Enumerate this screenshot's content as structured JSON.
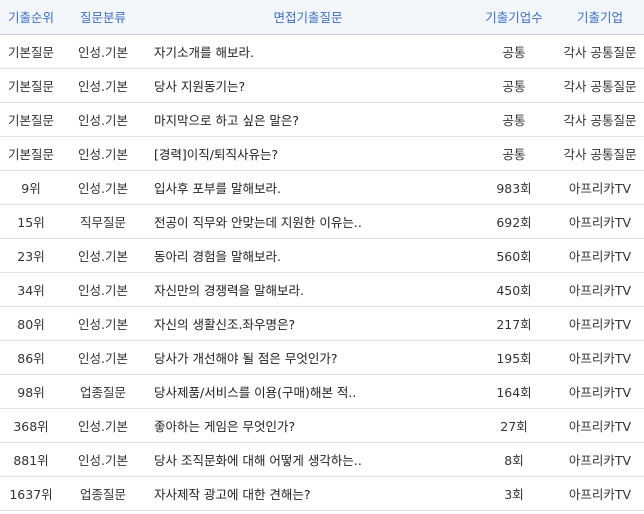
{
  "table": {
    "headers": [
      "기출순위",
      "질문분류",
      "면접기출질문",
      "기출기업수",
      "기출기업"
    ],
    "rows": [
      {
        "rank": "기본질문",
        "category": "인성.기본",
        "question": "자기소개를 해보라.",
        "count": "공통",
        "company": "각사 공통질문"
      },
      {
        "rank": "기본질문",
        "category": "인성.기본",
        "question": "당사 지원동기는?",
        "count": "공통",
        "company": "각사 공통질문"
      },
      {
        "rank": "기본질문",
        "category": "인성.기본",
        "question": "마지막으로 하고 싶은 말은?",
        "count": "공통",
        "company": "각사 공통질문"
      },
      {
        "rank": "기본질문",
        "category": "인성.기본",
        "question": "[경력]이직/퇴직사유는?",
        "count": "공통",
        "company": "각사 공통질문"
      },
      {
        "rank": "9위",
        "category": "인성.기본",
        "question": "입사후 포부를 말해보라.",
        "count": "983회",
        "company": "아프리카TV"
      },
      {
        "rank": "15위",
        "category": "직무질문",
        "question": "전공이 직무와 안맞는데 지원한 이유는..",
        "count": "692회",
        "company": "아프리카TV"
      },
      {
        "rank": "23위",
        "category": "인성.기본",
        "question": "동아리 경험을 말해보라.",
        "count": "560회",
        "company": "아프리카TV"
      },
      {
        "rank": "34위",
        "category": "인성.기본",
        "question": "자신만의 경쟁력을 말해보라.",
        "count": "450회",
        "company": "아프리카TV"
      },
      {
        "rank": "80위",
        "category": "인성.기본",
        "question": "자신의 생활신조.좌우명은?",
        "count": "217회",
        "company": "아프리카TV"
      },
      {
        "rank": "86위",
        "category": "인성.기본",
        "question": "당사가 개선해야 될 점은 무엇인가?",
        "count": "195회",
        "company": "아프리카TV"
      },
      {
        "rank": "98위",
        "category": "업종질문",
        "question": "당사제품/서비스를 이용(구매)해본 적..",
        "count": "164회",
        "company": "아프리카TV"
      },
      {
        "rank": "368위",
        "category": "인성.기본",
        "question": "좋아하는 게임은 무엇인가?",
        "count": "27회",
        "company": "아프리카TV"
      },
      {
        "rank": "881위",
        "category": "인성.기본",
        "question": "당사 조직문화에 대해 어떻게 생각하는..",
        "count": "8회",
        "company": "아프리카TV"
      },
      {
        "rank": "1637위",
        "category": "업종질문",
        "question": "자사제작 광고에 대한 견해는?",
        "count": "3회",
        "company": "아프리카TV"
      }
    ]
  }
}
